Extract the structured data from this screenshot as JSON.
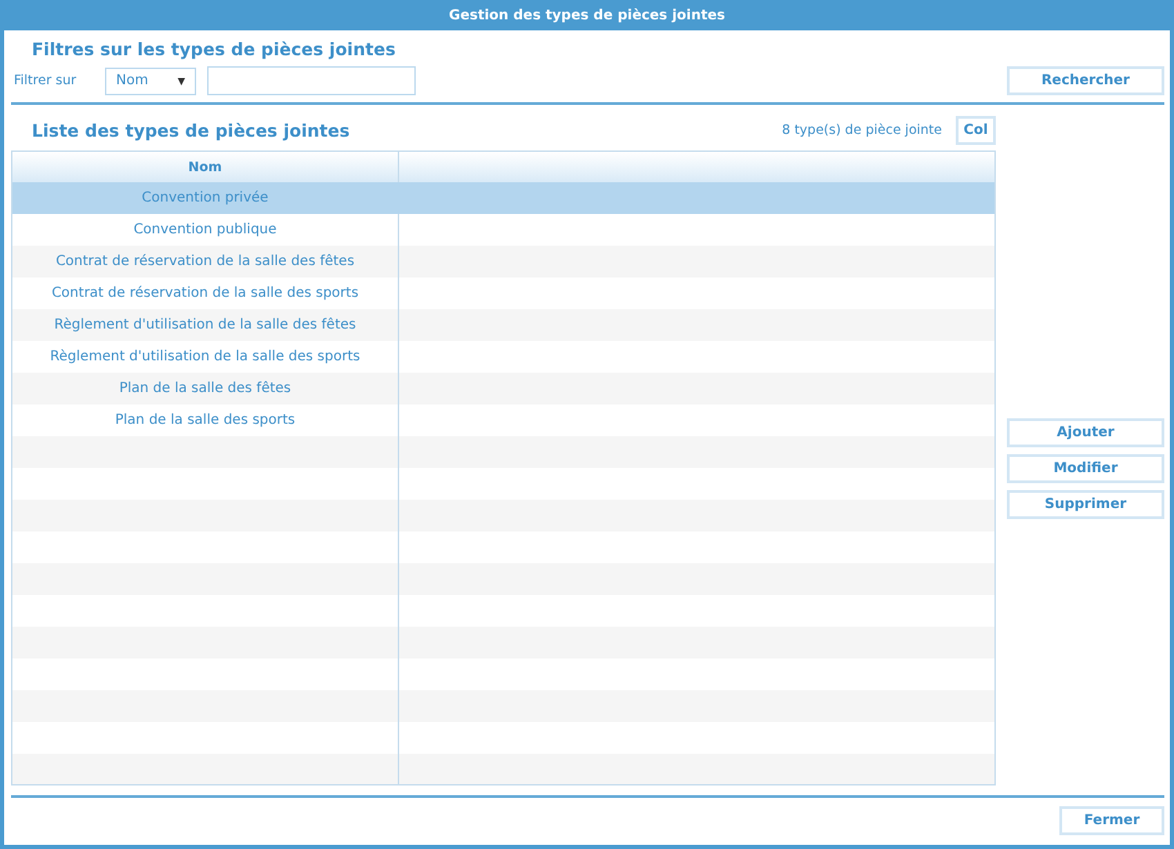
{
  "window": {
    "title": "Gestion des types de pièces jointes"
  },
  "filters": {
    "title": "Filtres sur les types de pièces jointes",
    "label": "Filtrer sur",
    "field_select": {
      "value": "Nom",
      "caret": "▼"
    },
    "search_button": "Rechercher"
  },
  "list": {
    "title": "Liste des types de pièces jointes",
    "count": "8 type(s) de pièce jointe",
    "columns_button": "Col"
  },
  "table": {
    "columns": [
      "Nom"
    ],
    "rows": [
      {
        "name": "Convention privée",
        "selected": true
      },
      {
        "name": "Convention publique",
        "selected": false
      },
      {
        "name": "Contrat de réservation de la salle des fêtes",
        "selected": false
      },
      {
        "name": "Contrat de réservation de la salle des sports",
        "selected": false
      },
      {
        "name": "Règlement d'utilisation de la salle des fêtes",
        "selected": false
      },
      {
        "name": "Règlement d'utilisation de la salle des sports",
        "selected": false
      },
      {
        "name": "Plan de la salle des fêtes",
        "selected": false
      },
      {
        "name": "Plan de la salle des sports",
        "selected": false
      }
    ]
  },
  "actions": [
    "Ajouter",
    "Modifier",
    "Supprimer"
  ],
  "footer": {
    "close_button": "Fermer"
  }
}
